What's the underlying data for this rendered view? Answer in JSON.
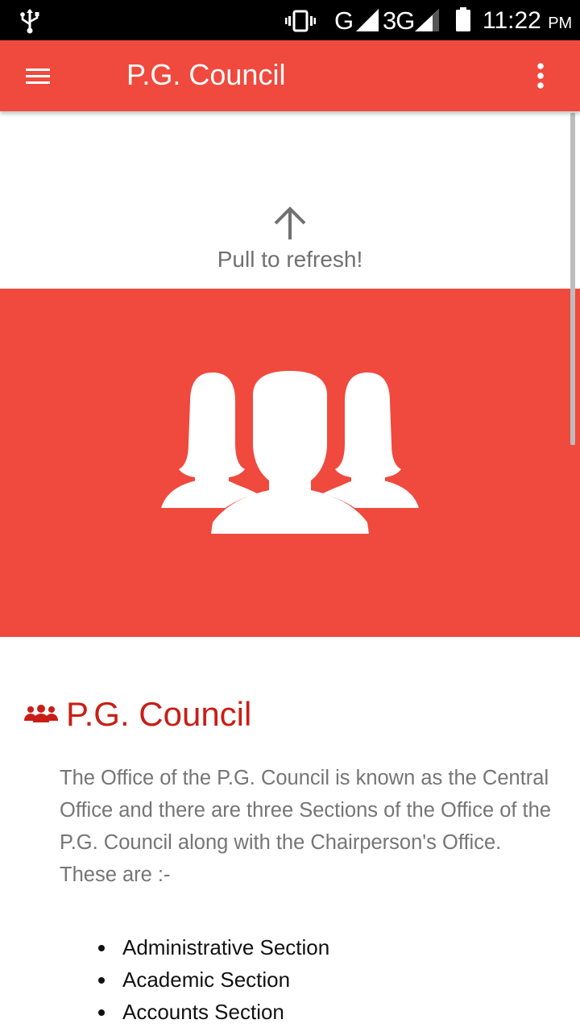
{
  "status_bar": {
    "network1": "G",
    "network2": "3G",
    "time": "11:22",
    "ampm": "PM",
    "icons": [
      "usb-icon",
      "vibrate-icon",
      "signal-icon",
      "signal-icon",
      "battery-icon"
    ]
  },
  "app_bar": {
    "title": "P.G. Council",
    "menu_icon": "hamburger-menu-icon",
    "overflow_icon": "more-vertical-icon"
  },
  "refresh": {
    "text": "Pull to refresh!",
    "icon": "arrow-up-icon"
  },
  "hero": {
    "icon": "group-people-icon",
    "background": "#f0493d"
  },
  "content": {
    "heading": "P.G. Council",
    "heading_icon": "group-icon",
    "paragraph": "The Office of the P.G. Council is known as the Central Office and there are three Sections of the Office of the P.G. Council along with the Chairperson's Office. These are :-",
    "list": [
      "Administrative Section",
      "Academic Section",
      "Accounts Section"
    ]
  },
  "colors": {
    "accent": "#f0493d",
    "heading": "#c81e16",
    "body_text": "#757575"
  }
}
